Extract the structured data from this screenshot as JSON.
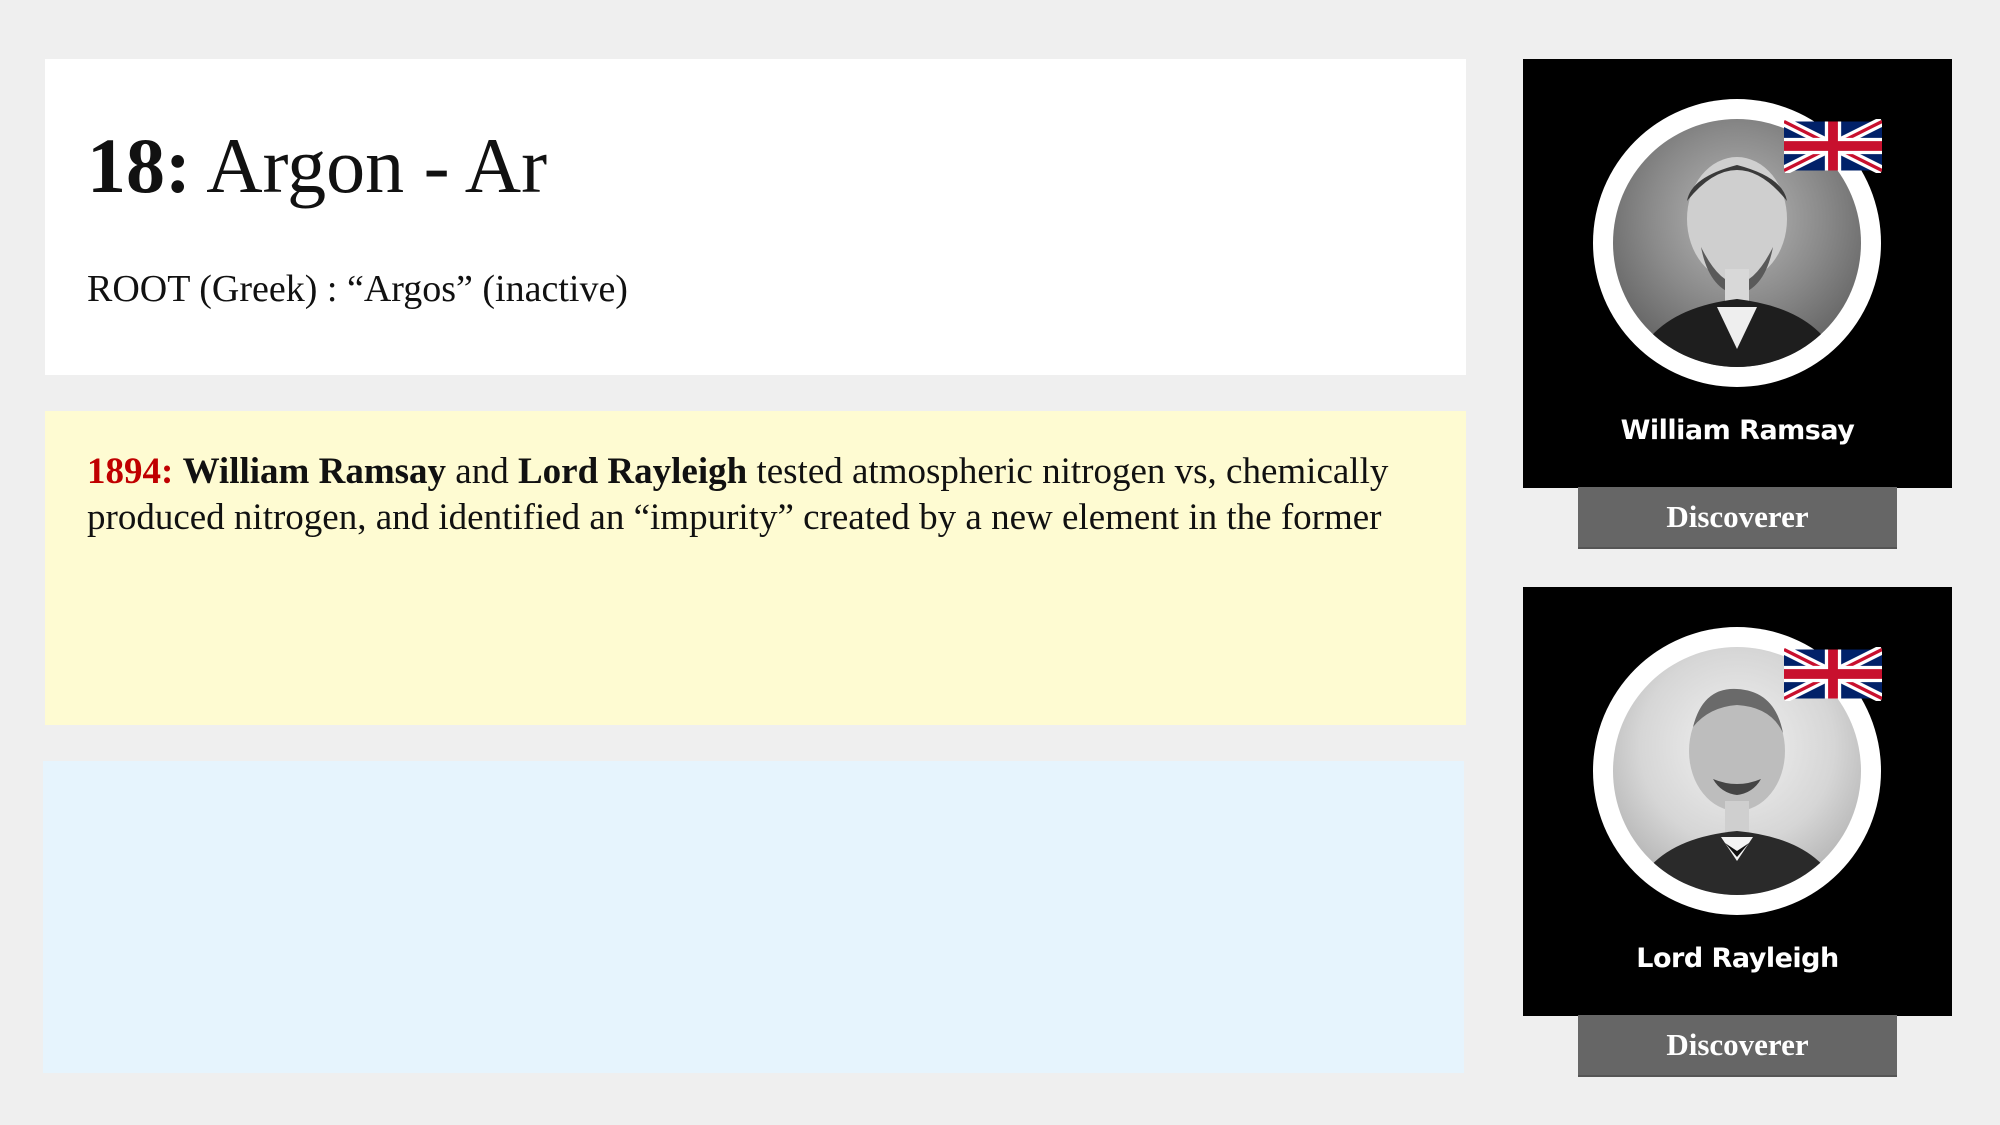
{
  "element": {
    "number": "18:",
    "name": "Argon - Ar"
  },
  "root": "ROOT (Greek) : “Argos” (inactive)",
  "fact": {
    "year": "1894:",
    "person1": "William Ramsay",
    "and": " and ",
    "person2": "Lord Rayleigh",
    "text": " tested atmospheric nitrogen vs, chemically produced nitrogen, and identified an “impurity” created by a new element in the former"
  },
  "discoverers": [
    {
      "name": "William Ramsay",
      "role": "Discoverer",
      "flag_icon": "uk-flag-icon"
    },
    {
      "name": "Lord Rayleigh",
      "role": "Discoverer",
      "flag_icon": "uk-flag-icon"
    }
  ],
  "colors": {
    "year_accent": "#c00000",
    "fact_panel": "#fefbd2",
    "blue_panel": "#e6f4fd",
    "role_tag": "#666666"
  }
}
